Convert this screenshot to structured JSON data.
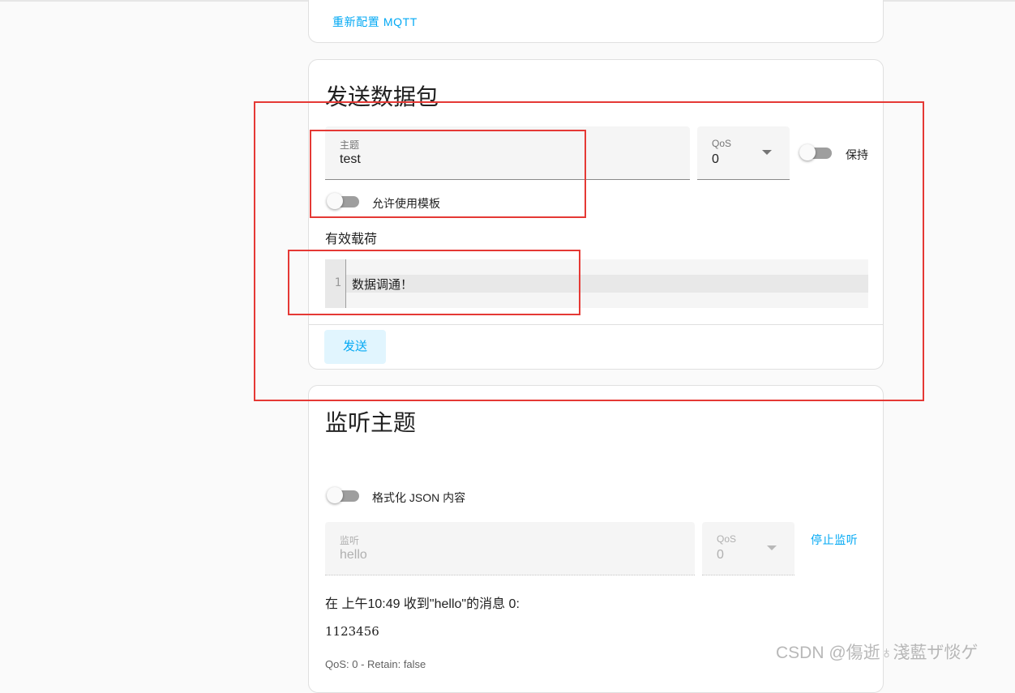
{
  "mqtt_card": {
    "reconfigure_label": "重新配置 MQTT"
  },
  "publish_card": {
    "title": "发送数据包",
    "topic": {
      "label": "主题",
      "value": "test"
    },
    "qos": {
      "label": "QoS",
      "value": "0"
    },
    "retain": {
      "label": "保持",
      "on": false
    },
    "allow_template": {
      "label": "允许使用模板",
      "on": false
    },
    "payload_label": "有效载荷",
    "editor": {
      "line_number": "1",
      "content": "数据调通！"
    },
    "send_label": "发送"
  },
  "listen_card": {
    "title": "监听主题",
    "format_json": {
      "label": "格式化 JSON 内容",
      "on": false
    },
    "topic": {
      "label": "监听",
      "value": "hello"
    },
    "qos": {
      "label": "QoS",
      "value": "0"
    },
    "stop_label": "停止监听",
    "message": {
      "header": "在 上午10:49 收到\"hello\"的消息 0:",
      "body": "1123456",
      "meta": "QoS: 0 - Retain: false"
    }
  },
  "watermark": "CSDN @傷逝♁淺藍ザ惔ゲ",
  "colors": {
    "accent": "#03a9f4",
    "highlight_border": "#e53935",
    "background": "#fafafa",
    "card": "#ffffff"
  }
}
